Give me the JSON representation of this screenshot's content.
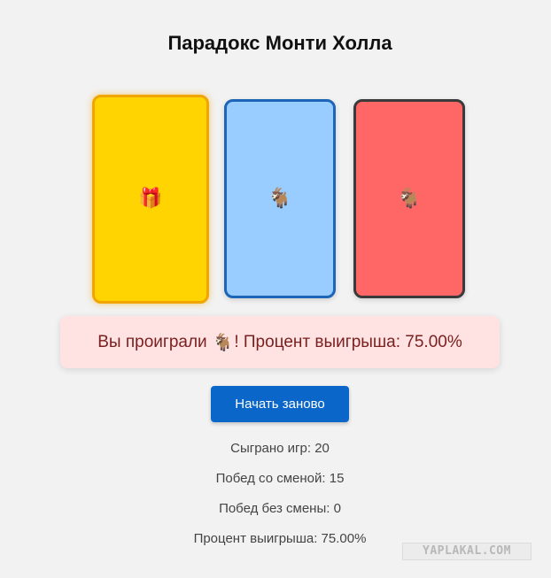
{
  "title": "Парадокс Монти Холла",
  "doors": [
    {
      "content": "🎁",
      "icon_name": "gift-icon",
      "color": "#ffd400",
      "border": "#f0a500",
      "selected": true
    },
    {
      "content": "🐐",
      "icon_name": "goat-icon",
      "color": "#99ccff",
      "border": "#1d65b8",
      "selected": false
    },
    {
      "content": "🐐",
      "icon_name": "goat-icon",
      "color": "#ff6666",
      "border": "#3a3a3a",
      "selected": false
    }
  ],
  "result": {
    "prefix": "Вы проиграли",
    "icon": "🐐",
    "suffix": "! Процент выигрыша: 75.00%",
    "background": "#ffe3e3",
    "text_color": "#7a1f1f"
  },
  "restart_button": {
    "label": "Начать заново",
    "color": "#0a66c8"
  },
  "stats": {
    "games_played": "Сыграно игр: 20",
    "wins_with_switch": "Побед со сменой: 15",
    "wins_without_switch": "Побед без смены: 0",
    "win_rate": "Процент выигрыша: 75.00%"
  },
  "watermark": "YAPLAKAL.COM"
}
